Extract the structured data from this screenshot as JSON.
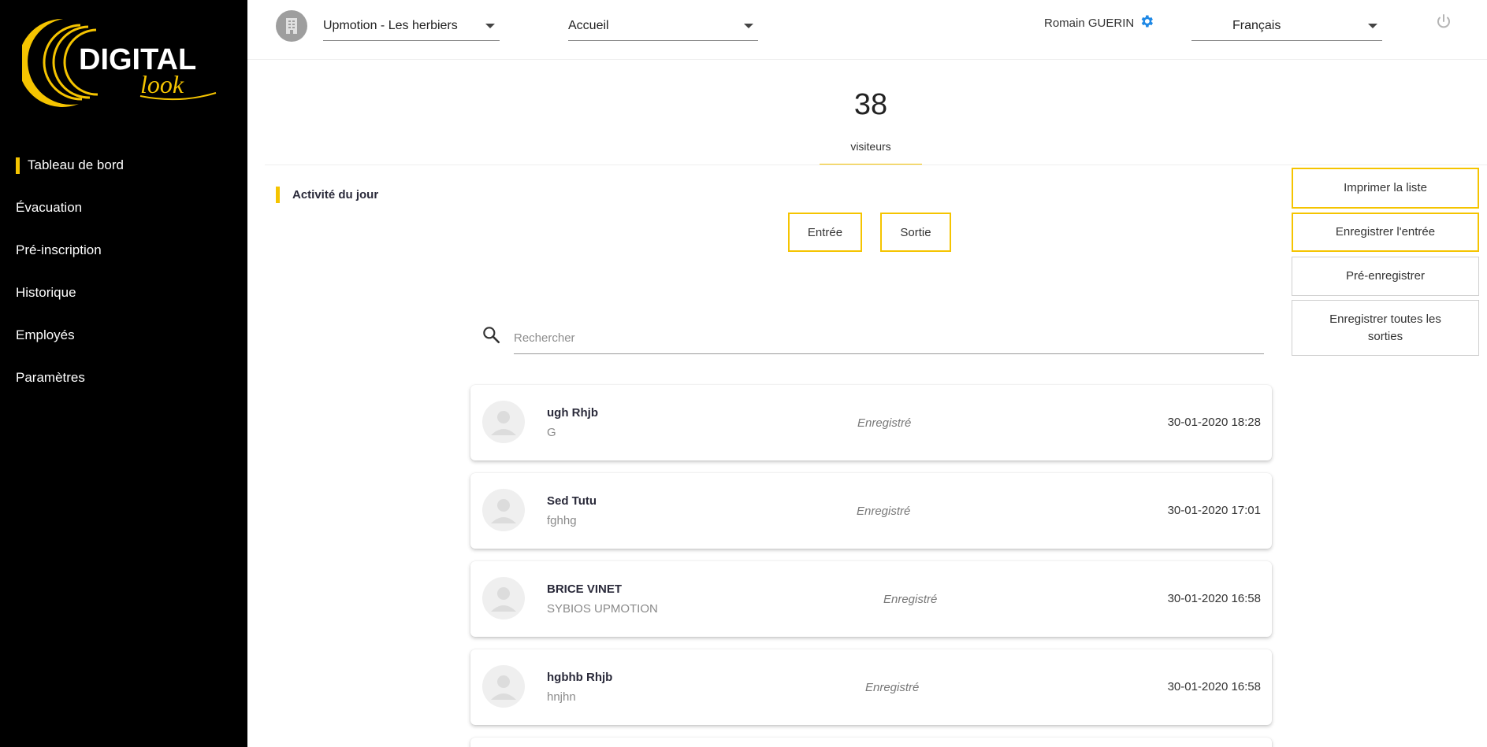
{
  "brand": {
    "logo_name": "DIGITAL look",
    "accent_color": "#f5c400"
  },
  "sidebar": {
    "items": [
      {
        "label": "Tableau de bord",
        "active": true
      },
      {
        "label": "Évacuation",
        "active": false
      },
      {
        "label": "Pré-inscription",
        "active": false
      },
      {
        "label": "Historique",
        "active": false
      },
      {
        "label": "Employés",
        "active": false
      },
      {
        "label": "Paramètres",
        "active": false
      }
    ]
  },
  "header": {
    "site_select": "Upmotion - Les herbiers",
    "page_select": "Accueil",
    "user_name": "Romain GUERIN",
    "language_select": "Français"
  },
  "counter": {
    "value": "38",
    "label": "visiteurs"
  },
  "activity": {
    "title": "Activité du jour"
  },
  "filters": {
    "entry_label": "Entrée",
    "exit_label": "Sortie"
  },
  "actions": {
    "print_label": "Imprimer la liste",
    "register_entry_label": "Enregistrer l'entrée",
    "preregister_label": "Pré-enregistrer",
    "register_all_exits_label": "Enregistrer toutes les sorties"
  },
  "search": {
    "placeholder": "Rechercher",
    "value": ""
  },
  "visitors": [
    {
      "name": "ugh Rhjb",
      "company": "G",
      "status": "Enregistré",
      "datetime": "30-01-2020 18:28"
    },
    {
      "name": "Sed Tutu",
      "company": "fghhg",
      "status": "Enregistré",
      "datetime": "30-01-2020 17:01"
    },
    {
      "name": "BRICE VINET",
      "company": "SYBIOS UPMOTION",
      "status": "Enregistré",
      "datetime": "30-01-2020 16:58"
    },
    {
      "name": "hgbhb Rhjb",
      "company": "hnjhn",
      "status": "Enregistré",
      "datetime": "30-01-2020 16:58"
    }
  ]
}
